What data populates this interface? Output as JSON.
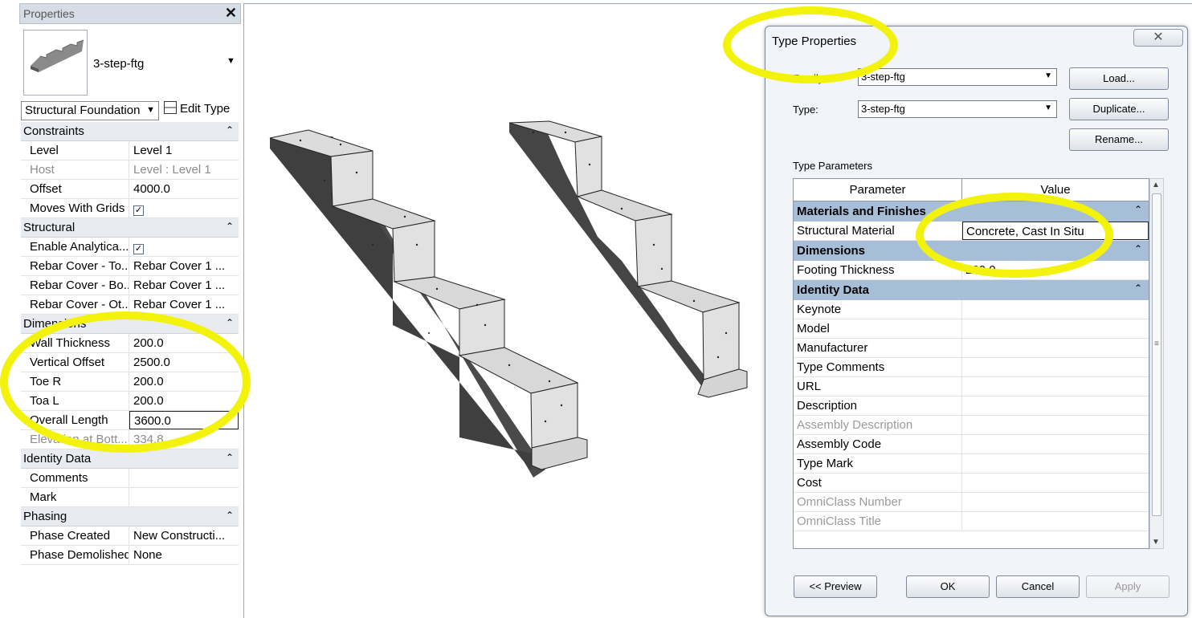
{
  "properties": {
    "title": "Properties",
    "close_glyph": "✕",
    "type_name": "3-step-ftg",
    "category": "Structural Foundation",
    "edit_type_label": "Edit Type",
    "groups": [
      {
        "name": "Constraints",
        "rows": [
          {
            "name": "Level",
            "value": "Level 1",
            "disabled": false
          },
          {
            "name": "Host",
            "value": "Level : Level 1",
            "disabled": true
          },
          {
            "name": "Offset",
            "value": "4000.0",
            "disabled": false
          },
          {
            "name": "Moves With Grids",
            "value": "",
            "checkbox": true,
            "checked": true,
            "disabled": false
          }
        ]
      },
      {
        "name": "Structural",
        "rows": [
          {
            "name": "Enable Analytica...",
            "value": "",
            "checkbox": true,
            "checked": true,
            "disabled": false
          },
          {
            "name": "Rebar Cover - To...",
            "value": "Rebar Cover 1 ...",
            "disabled": false
          },
          {
            "name": "Rebar Cover - Bo...",
            "value": "Rebar Cover 1 ...",
            "disabled": false
          },
          {
            "name": "Rebar Cover - Ot...",
            "value": "Rebar Cover 1 ...",
            "disabled": false
          }
        ]
      },
      {
        "name": "Dimensions",
        "rows": [
          {
            "name": "Wall Thickness",
            "value": "200.0",
            "disabled": false
          },
          {
            "name": "Vertical Offset",
            "value": "2500.0",
            "disabled": false
          },
          {
            "name": "Toe R",
            "value": "200.0",
            "disabled": false
          },
          {
            "name": "Toa L",
            "value": "200.0",
            "disabled": false
          },
          {
            "name": "Overall Length",
            "value": "3600.0",
            "disabled": false,
            "editing": true
          },
          {
            "name": "Elevation at Bott...",
            "value": "334.8",
            "disabled": true
          }
        ]
      },
      {
        "name": "Identity Data",
        "rows": [
          {
            "name": "Comments",
            "value": "",
            "disabled": false
          },
          {
            "name": "Mark",
            "value": "",
            "disabled": false
          }
        ]
      },
      {
        "name": "Phasing",
        "rows": [
          {
            "name": "Phase Created",
            "value": "New Constructi...",
            "disabled": false
          },
          {
            "name": "Phase Demolished",
            "value": "None",
            "disabled": false
          }
        ]
      }
    ]
  },
  "dialog": {
    "title": "Type Properties",
    "close_glyph": "✕",
    "family_label": "Family:",
    "family_value": "3-step-ftg",
    "type_label": "Type:",
    "type_value": "3-step-ftg",
    "load_label": "Load...",
    "duplicate_label": "Duplicate...",
    "rename_label": "Rename...",
    "type_params_label": "Type Parameters",
    "col_parameter": "Parameter",
    "col_value": "Value",
    "groups": [
      {
        "name": "Materials and Finishes",
        "rows": [
          {
            "name": "Structural Material",
            "value": "Concrete, Cast In Situ",
            "boxed": true
          }
        ]
      },
      {
        "name": "Dimensions",
        "rows": [
          {
            "name": "Footing Thickness",
            "value": "200.0"
          }
        ]
      },
      {
        "name": "Identity Data",
        "rows": [
          {
            "name": "Keynote",
            "value": ""
          },
          {
            "name": "Model",
            "value": ""
          },
          {
            "name": "Manufacturer",
            "value": ""
          },
          {
            "name": "Type Comments",
            "value": ""
          },
          {
            "name": "URL",
            "value": ""
          },
          {
            "name": "Description",
            "value": ""
          },
          {
            "name": "Assembly Description",
            "value": "",
            "disabled": true
          },
          {
            "name": "Assembly Code",
            "value": ""
          },
          {
            "name": "Type Mark",
            "value": ""
          },
          {
            "name": "Cost",
            "value": ""
          },
          {
            "name": "OmniClass Number",
            "value": "",
            "disabled": true
          },
          {
            "name": "OmniClass Title",
            "value": "",
            "disabled": true
          }
        ]
      }
    ],
    "preview_label": "<< Preview",
    "ok_label": "OK",
    "cancel_label": "Cancel",
    "apply_label": "Apply"
  },
  "colors": {
    "highlight": "#f2f20a",
    "group_header_blue": "#a7bed8",
    "concrete_face": "#dcdcdc",
    "concrete_side": "#4a4a4a"
  },
  "icons": [
    "close-icon",
    "dropdown-arrow-icon",
    "edit-type-icon",
    "collapse-icon",
    "checkbox-icon",
    "footing-thumbnail-icon"
  ]
}
